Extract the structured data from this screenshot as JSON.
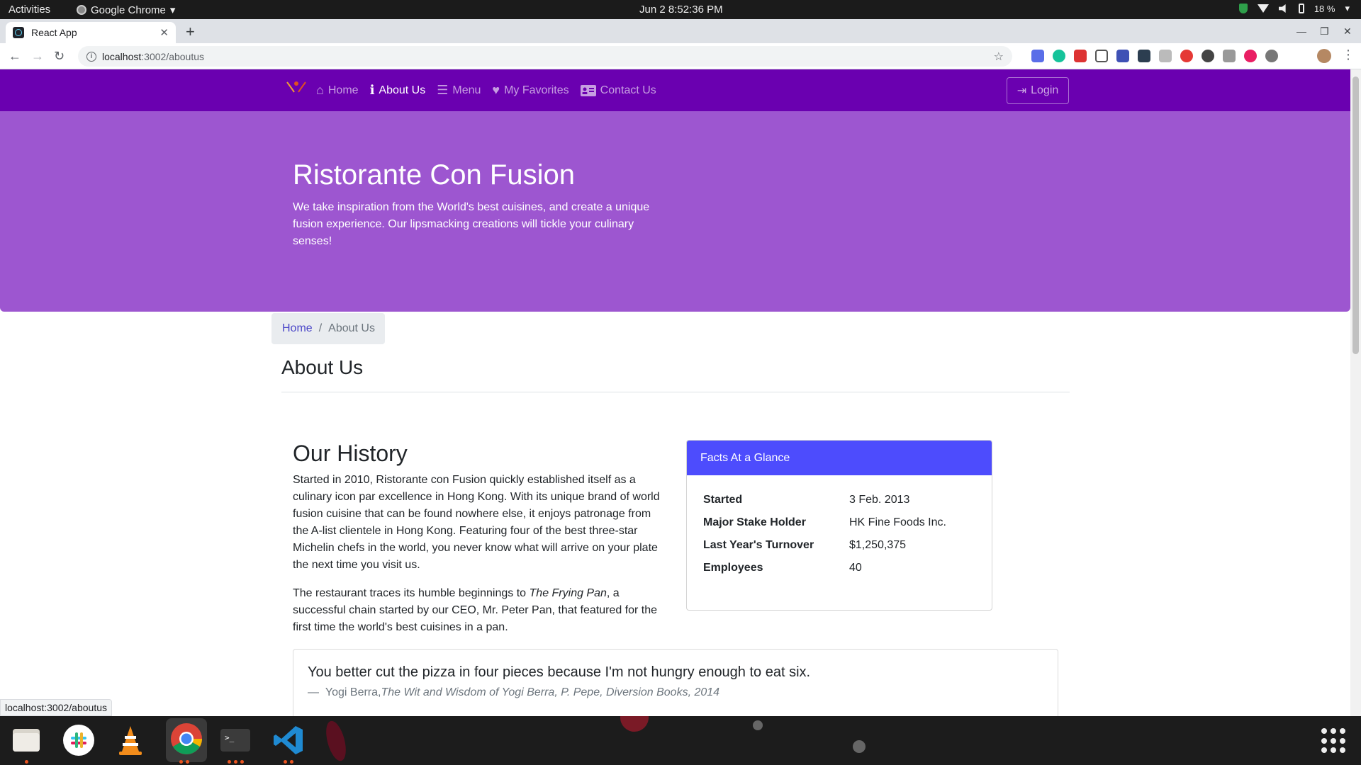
{
  "os": {
    "activities": "Activities",
    "app_menu": "Google Chrome",
    "clock": "Jun 2   8:52:36 PM",
    "battery": "18 %"
  },
  "browser": {
    "tab_title": "React App",
    "url_host": "localhost",
    "url_path": ":3002/aboutus",
    "status_url": "localhost:3002/aboutus"
  },
  "navbar": {
    "links": [
      {
        "label": "Home",
        "icon": "home-icon"
      },
      {
        "label": "About Us",
        "icon": "info-icon"
      },
      {
        "label": "Menu",
        "icon": "list-icon"
      },
      {
        "label": "My Favorites",
        "icon": "heart-icon"
      },
      {
        "label": "Contact Us",
        "icon": "address-card-icon"
      }
    ],
    "active": "About Us",
    "login_label": "Login"
  },
  "jumbotron": {
    "title": "Ristorante Con Fusion",
    "text": "We take inspiration from the World's best cuisines, and create a unique fusion experience. Our lipsmacking creations will tickle your culinary senses!"
  },
  "breadcrumb": {
    "home": "Home",
    "current": "About Us"
  },
  "page": {
    "title": "About Us"
  },
  "history": {
    "heading": "Our History",
    "p1": "Started in 2010, Ristorante con Fusion quickly established itself as a culinary icon par excellence in Hong Kong. With its unique brand of world fusion cuisine that can be found nowhere else, it enjoys patronage from the A-list clientele in Hong Kong. Featuring four of the best three-star Michelin chefs in the world, you never know what will arrive on your plate the next time you visit us.",
    "p2_before": "The restaurant traces its humble beginnings to ",
    "p2_em": "The Frying Pan",
    "p2_after": ", a successful chain started by our CEO, Mr. Peter Pan, that featured for the first time the world's best cuisines in a pan."
  },
  "facts": {
    "header": "Facts At a Glance",
    "rows": [
      {
        "key": "Started",
        "value": "3 Feb. 2013"
      },
      {
        "key": "Major Stake Holder",
        "value": "HK Fine Foods Inc."
      },
      {
        "key": "Last Year's Turnover",
        "value": "$1,250,375"
      },
      {
        "key": "Employees",
        "value": "40"
      }
    ]
  },
  "quote": {
    "text": "You better cut the pizza in four pieces because I'm not hungry enough to eat six.",
    "dash": "—",
    "author": "Yogi Berra,",
    "citation": "The Wit and Wisdom of Yogi Berra, P. Pepe, Diversion Books, 2014"
  },
  "colors": {
    "navbar": "#6a00b0",
    "jumbotron": "#9d56d0",
    "card_header": "#4d4cfd",
    "link": "#4b47c8"
  }
}
